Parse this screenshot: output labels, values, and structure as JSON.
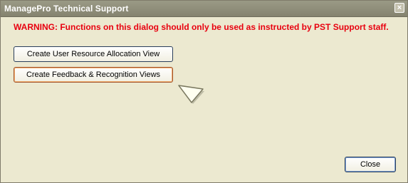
{
  "window": {
    "title": "ManagePro Technical Support",
    "close_glyph": "×"
  },
  "warning": "WARNING: Functions on this dialog should only be used as instructed by PST Support staff.",
  "buttons": {
    "create_resource_allocation": "Create User Resource Allocation View",
    "create_feedback_recognition": "Create Feedback & Recognition Views",
    "close": "Close"
  },
  "icons": {
    "close": "close-icon",
    "pointer": "mouse-pointer-icon"
  },
  "colors": {
    "warning_text": "#e8000f",
    "dialog_bg": "#ece9d0",
    "titlebar": "#8f8e7a"
  }
}
